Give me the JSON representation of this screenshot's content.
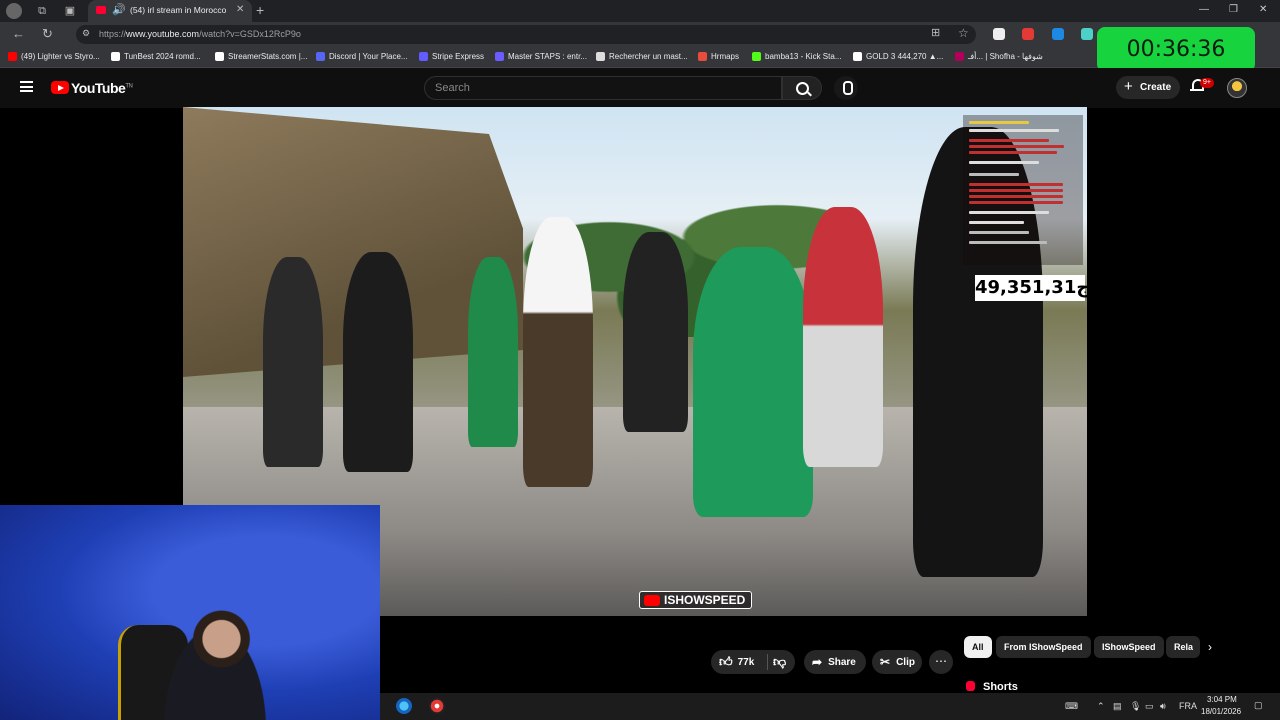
{
  "browser": {
    "tab_title": "(54) irl stream in Morocco",
    "url_prefix": "https://",
    "url_domain": "www.youtube.com",
    "url_path": "/watch?v=GSDx12RcP9o",
    "bookmarks": [
      {
        "label": "(49) Lighter vs Styro...",
        "color": "#ff0000"
      },
      {
        "label": "TunBest 2024 romd...",
        "color": "#ffffff"
      },
      {
        "label": "StreamerStats.com |...",
        "color": "#ffffff"
      },
      {
        "label": "Discord | Your Place...",
        "color": "#5865f2"
      },
      {
        "label": "Stripe Express",
        "color": "#635bff"
      },
      {
        "label": "Master STAPS : entr...",
        "color": "#6b5cff"
      },
      {
        "label": "Rechercher un mast...",
        "color": "#dddddd"
      },
      {
        "label": "Hrmaps",
        "color": "#e84c3d"
      },
      {
        "label": "bamba13 - Kick Sta...",
        "color": "#53fc18"
      },
      {
        "label": "GOLD 3 444,270 ▲...",
        "color": "#ffffff"
      },
      {
        "label": "أفـ... | Shofha - شوفها",
        "color": "#b0005a"
      }
    ]
  },
  "timer": "00:36:36",
  "youtube": {
    "logo_text": "YouTube",
    "logo_region": "TN",
    "search_placeholder": "Search",
    "create_label": "Create",
    "notification_badge": "9+"
  },
  "video": {
    "viewer_count": "49,351,31ج",
    "watermark": "ISHOWSPEED"
  },
  "actions": {
    "like_count": "77k",
    "share_label": "Share",
    "clip_label": "Clip"
  },
  "chips": [
    "All",
    "From IShowSpeed",
    "IShowSpeed",
    "Rela"
  ],
  "shorts_label": "Shorts",
  "taskbar": {
    "language": "FRA",
    "time": "3:04 PM",
    "date": "18/01/2026"
  },
  "colors": {
    "timer_bg": "#17d43e",
    "youtube_red": "#ff0000",
    "page_bg": "#0f0f0f"
  }
}
